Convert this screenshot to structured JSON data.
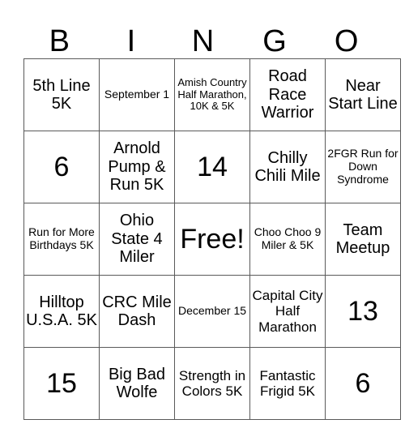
{
  "header": {
    "letters": [
      "B",
      "I",
      "N",
      "G",
      "O"
    ]
  },
  "grid": {
    "rows": [
      [
        {
          "text": "5th Line 5K",
          "size": "l"
        },
        {
          "text": "September 1",
          "size": "s"
        },
        {
          "text": "Amish Country Half Marathon, 10K & 5K",
          "size": "xs"
        },
        {
          "text": "Road Race Warrior",
          "size": "l"
        },
        {
          "text": "Near Start Line",
          "size": "l"
        }
      ],
      [
        {
          "text": "6",
          "size": "xl"
        },
        {
          "text": "Arnold Pump & Run 5K",
          "size": "l"
        },
        {
          "text": "14",
          "size": "xl"
        },
        {
          "text": "Chilly Chili Mile",
          "size": "l"
        },
        {
          "text": "2FGR Run for Down Syndrome",
          "size": "s"
        }
      ],
      [
        {
          "text": "Run for More Birthdays 5K",
          "size": "s"
        },
        {
          "text": "Ohio State 4 Miler",
          "size": "l"
        },
        {
          "text": "Free!",
          "size": "xl"
        },
        {
          "text": "Choo Choo 9 Miler & 5K",
          "size": "s"
        },
        {
          "text": "Team Meetup",
          "size": "l"
        }
      ],
      [
        {
          "text": "Hilltop U.S.A. 5K",
          "size": "l"
        },
        {
          "text": "CRC Mile Dash",
          "size": "l"
        },
        {
          "text": "December 15",
          "size": "s"
        },
        {
          "text": "Capital City Half Marathon",
          "size": "m"
        },
        {
          "text": "13",
          "size": "xl"
        }
      ],
      [
        {
          "text": "15",
          "size": "xl"
        },
        {
          "text": "Big Bad Wolfe",
          "size": "l"
        },
        {
          "text": "Strength in Colors 5K",
          "size": "m"
        },
        {
          "text": "Fantastic Frigid 5K",
          "size": "m"
        },
        {
          "text": "6",
          "size": "xl"
        }
      ]
    ]
  }
}
